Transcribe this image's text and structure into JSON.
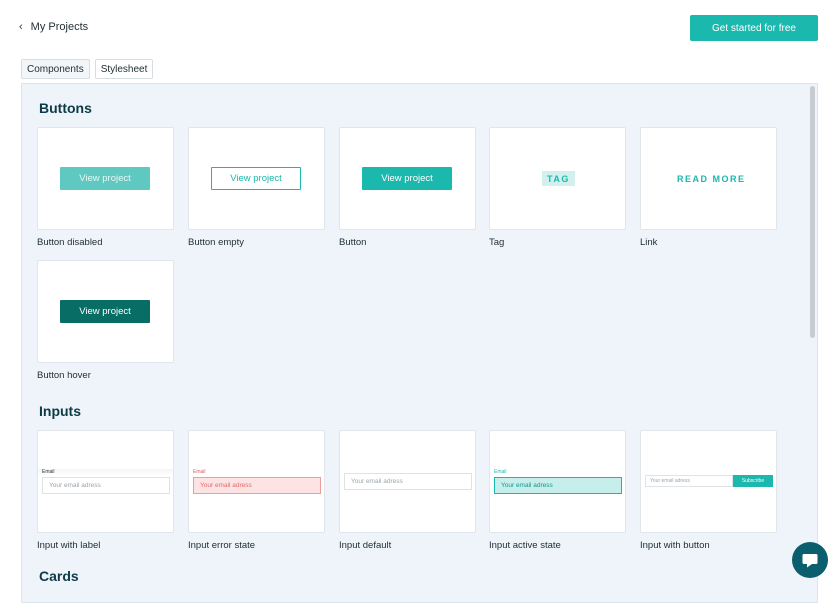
{
  "header": {
    "back_label": "My Projects",
    "cta_label": "Get started for free"
  },
  "tabs": [
    {
      "label": "Components",
      "active": true
    },
    {
      "label": "Stylesheet",
      "active": false
    }
  ],
  "sections": {
    "buttons": {
      "title": "Buttons",
      "items": [
        {
          "caption": "Button disabled",
          "label": "View project"
        },
        {
          "caption": "Button empty",
          "label": "View project"
        },
        {
          "caption": "Button",
          "label": "View project"
        },
        {
          "caption": "Tag",
          "label": "TAG"
        },
        {
          "caption": "Link",
          "label": "READ MORE"
        },
        {
          "caption": "Button hover",
          "label": "View project"
        }
      ]
    },
    "inputs": {
      "title": "Inputs",
      "items": [
        {
          "caption": "Input with label",
          "field_label": "Email",
          "placeholder": "Your email adress"
        },
        {
          "caption": "Input error state",
          "field_label": "Email",
          "placeholder": "Your email adress"
        },
        {
          "caption": "Input default",
          "placeholder": "Your email adress"
        },
        {
          "caption": "Input active state",
          "field_label": "Email",
          "placeholder": "Your email adress"
        },
        {
          "caption": "Input with button",
          "placeholder": "Your email adress",
          "button_label": "Subscribe"
        }
      ]
    },
    "cards": {
      "title": "Cards"
    }
  },
  "colors": {
    "accent": "#1bb8ad",
    "accent_dark": "#086d64",
    "panel_bg": "#eef4fa",
    "title": "#0e3a48"
  },
  "icons": {
    "back": "chevron-left-icon",
    "chat": "chat-bubble-icon"
  }
}
